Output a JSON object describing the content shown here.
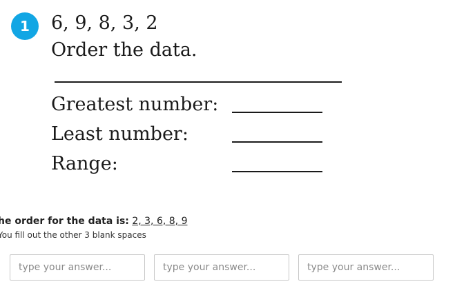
{
  "question": {
    "number": "1",
    "data_set": "6, 9, 8, 3, 2",
    "instruction": "Order the data."
  },
  "rows": {
    "greatest": "Greatest number:",
    "least": "Least number:",
    "range": "Range:"
  },
  "note": {
    "lead": "he order for the data is:",
    "answer": "2, 3, 6, 8, 9",
    "sub": "You fill out the other 3 blank spaces"
  },
  "inputs": {
    "placeholder": "type your answer..."
  },
  "colors": {
    "badge": "#12a6e4",
    "input_border": "#c7c7c7"
  }
}
